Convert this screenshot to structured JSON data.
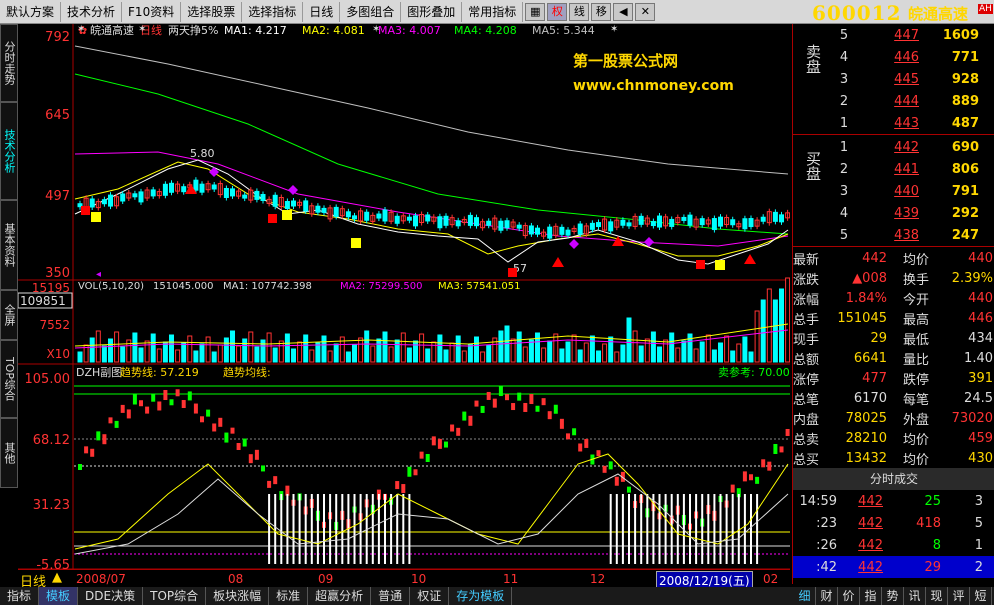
{
  "menu": [
    "默认方案",
    "技术分析",
    "F10资料",
    "选择股票",
    "选择指标",
    "日线",
    "多图组合",
    "图形叠加",
    "常用指标"
  ],
  "toolbar": [
    "权",
    "线",
    "移"
  ],
  "stock": {
    "code": "600012",
    "name": "皖通高速",
    "badge": "AH"
  },
  "left_tabs": [
    "分时走势",
    "技术分析",
    "基本资料",
    "全屏",
    "TOP综合",
    "其他"
  ],
  "main": {
    "title": "皖通高速",
    "period": "日线",
    "two_day": "两天挣5%",
    "ma": [
      {
        "label": "MA1: 4.217",
        "color": "#ffffff"
      },
      {
        "label": "MA2: 4.081",
        "color": "#ffff00"
      },
      {
        "label": "MA3: 4.007",
        "color": "#ff00ff"
      },
      {
        "label": "MA4: 4.208",
        "color": "#00ff00"
      },
      {
        "label": "MA5: 5.344",
        "color": "#c0c0c0"
      }
    ],
    "y_labels": [
      "792",
      "645",
      "497",
      "350"
    ],
    "watermark1": "第一股票公式网",
    "watermark2": "www.chnmoney.com",
    "high_mark": "5.80",
    "low_mark": "57"
  },
  "vol": {
    "header": "VOL(5,10,20)",
    "vol": "151045.000",
    "ma1": "MA1: 107742.398",
    "ma2": "MA2: 75299.500",
    "ma3": "MA3: 57541.051",
    "y_labels": [
      "15195",
      "7552",
      "X10"
    ],
    "side": "109851"
  },
  "ind": {
    "title": "DZH副图",
    "trend": "趋势线: 57.219",
    "trend_avg": "趋势均线: ",
    "sell_ref": "卖参考: 70.00",
    "y_labels": [
      "105.00",
      "68.12",
      "31.23",
      "-5.65"
    ]
  },
  "axis": {
    "period": "日线",
    "dates": [
      "2008/07",
      "08",
      "09",
      "10",
      "11",
      "12",
      "2008/12/19(五)",
      "02"
    ]
  },
  "orderbook": {
    "sell_label": "卖盘",
    "buy_label": "买盘",
    "sell": [
      [
        "5",
        "447",
        "1609"
      ],
      [
        "4",
        "446",
        "771"
      ],
      [
        "3",
        "445",
        "928"
      ],
      [
        "2",
        "444",
        "889"
      ],
      [
        "1",
        "443",
        "487"
      ]
    ],
    "buy": [
      [
        "1",
        "442",
        "690"
      ],
      [
        "2",
        "441",
        "806"
      ],
      [
        "3",
        "440",
        "791"
      ],
      [
        "4",
        "439",
        "292"
      ],
      [
        "5",
        "438",
        "247"
      ]
    ]
  },
  "stats": [
    [
      "最新",
      "442",
      "#f33",
      "均价",
      "440",
      "#f33"
    ],
    [
      "涨跌",
      "▲008",
      "#f33",
      "换手",
      "2.39%",
      "#ffd700"
    ],
    [
      "涨幅",
      "1.84%",
      "#f33",
      "今开",
      "440",
      "#f33"
    ],
    [
      "总手",
      "151045",
      "#ffd700",
      "最高",
      "446",
      "#f33"
    ],
    [
      "现手",
      "29",
      "#ffd700",
      "最低",
      "434",
      "#ddd"
    ],
    [
      "总额",
      "6641",
      "#ffd700",
      "量比",
      "1.40",
      "#ddd"
    ],
    [
      "涨停",
      "477",
      "#f33",
      "跌停",
      "391",
      "#ffd700"
    ],
    [
      "总笔",
      "6170",
      "#ddd",
      "每笔",
      "24.5",
      "#ddd"
    ],
    [
      "内盘",
      "78025",
      "#ffd700",
      "外盘",
      "73020",
      "#f33"
    ],
    [
      "总卖",
      "28210",
      "#ffd700",
      "均价",
      "459",
      "#f33"
    ],
    [
      "总买",
      "13432",
      "#ffd700",
      "均价",
      "430",
      "#ffd700"
    ]
  ],
  "ticks_header": "分时成交",
  "ticks": [
    [
      "14:59",
      "442",
      "25",
      "3"
    ],
    [
      ":23",
      "442",
      "418",
      "5"
    ],
    [
      ":26",
      "442",
      "8",
      "1"
    ],
    [
      ":42",
      "442",
      "29",
      "2"
    ]
  ],
  "bottom_tabs": [
    "指标",
    "模板",
    "DDE决策",
    "TOP综合",
    "板块涨幅",
    "标准",
    "超赢分析",
    "普通",
    "权证",
    "存为模板"
  ],
  "right_bottom_tabs": [
    "细",
    "财",
    "价",
    "指",
    "势",
    "讯",
    "现",
    "评",
    "短"
  ],
  "colors": {
    "up": "#ff3333",
    "down": "#00ffff",
    "accent": "#ffd700"
  }
}
